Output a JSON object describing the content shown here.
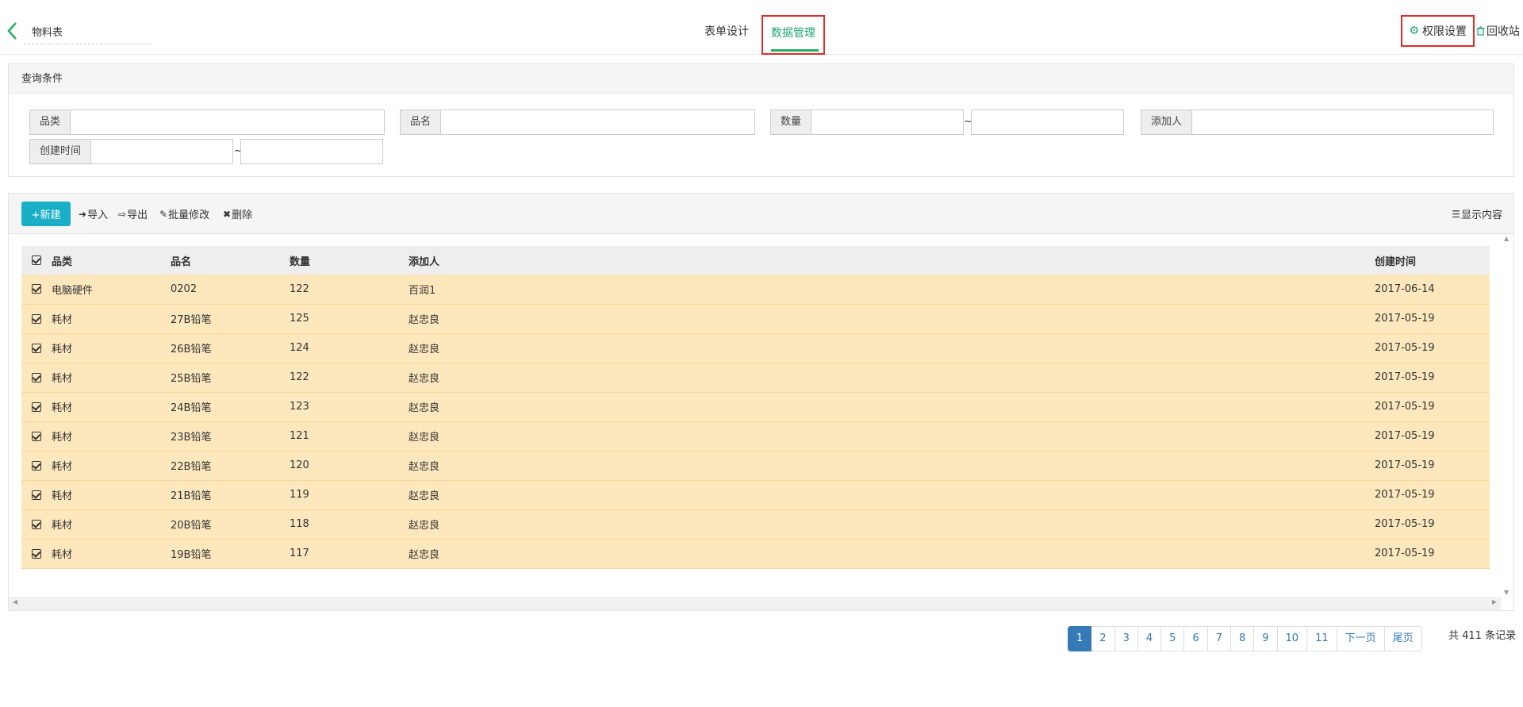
{
  "header": {
    "form_title": "物料表",
    "tabs": [
      {
        "label": "表单设计",
        "active": false
      },
      {
        "label": "数据管理",
        "active": true
      }
    ],
    "permission_label": "权限设置",
    "recycle_label": "回收站"
  },
  "query": {
    "title": "查询条件",
    "fields": {
      "category": "品类",
      "name": "品名",
      "quantity": "数量",
      "adder": "添加人",
      "created": "创建时间"
    },
    "tilde": "~"
  },
  "toolbar": {
    "new_label": "+新建",
    "import_label": "导入",
    "export_label": "导出",
    "batch_label": "批量修改",
    "delete_label": "删除",
    "show_label": "显示内容"
  },
  "table": {
    "headers": [
      "品类",
      "品名",
      "数量",
      "添加人",
      "创建时间"
    ],
    "rows": [
      [
        "电脑硬件",
        "0202",
        "122",
        "百润1",
        "2017-06-14"
      ],
      [
        "耗材",
        "27B铅笔",
        "125",
        "赵忠良",
        "2017-05-19"
      ],
      [
        "耗材",
        "26B铅笔",
        "124",
        "赵忠良",
        "2017-05-19"
      ],
      [
        "耗材",
        "25B铅笔",
        "122",
        "赵忠良",
        "2017-05-19"
      ],
      [
        "耗材",
        "24B铅笔",
        "123",
        "赵忠良",
        "2017-05-19"
      ],
      [
        "耗材",
        "23B铅笔",
        "121",
        "赵忠良",
        "2017-05-19"
      ],
      [
        "耗材",
        "22B铅笔",
        "120",
        "赵忠良",
        "2017-05-19"
      ],
      [
        "耗材",
        "21B铅笔",
        "119",
        "赵忠良",
        "2017-05-19"
      ],
      [
        "耗材",
        "20B铅笔",
        "118",
        "赵忠良",
        "2017-05-19"
      ],
      [
        "耗材",
        "19B铅笔",
        "117",
        "赵忠良",
        "2017-05-19"
      ]
    ]
  },
  "pagination": {
    "pages": [
      "1",
      "2",
      "3",
      "4",
      "5",
      "6",
      "7",
      "8",
      "9",
      "10",
      "11"
    ],
    "current": "1",
    "next_label": "下一页",
    "last_label": "尾页",
    "total_text": "共 411 条记录"
  },
  "colors": {
    "accent": "#21a37a",
    "new_button": "#1aafc6",
    "row_highlight": "#fde8be",
    "pager_active": "#337ab7",
    "focus_box": "#e12a2a"
  },
  "icons": {
    "back": "chevron-left-icon",
    "permission": "gear-icon",
    "recycle": "trash-icon",
    "import": "sign-in-icon",
    "export": "sign-out-icon",
    "batch": "edit-icon",
    "delete": "times-icon",
    "show": "list-icon"
  }
}
